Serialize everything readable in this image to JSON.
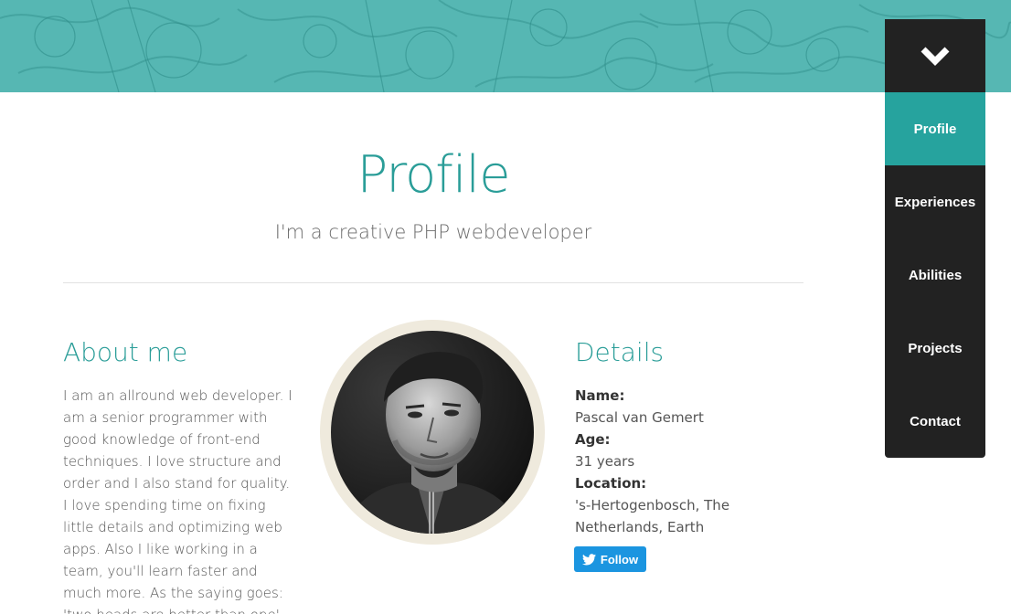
{
  "colors": {
    "accent": "#2a9d98",
    "nav_bg": "#222222",
    "nav_active": "#26a39e",
    "banner": "#55b6b3",
    "twitter": "#1b95e0"
  },
  "nav": {
    "toggle_icon": "chevron-down-icon",
    "items": [
      {
        "label": "Profile",
        "active": true
      },
      {
        "label": "Experiences",
        "active": false
      },
      {
        "label": "Abilities",
        "active": false
      },
      {
        "label": "Projects",
        "active": false
      },
      {
        "label": "Contact",
        "active": false
      }
    ]
  },
  "header": {
    "title": "Profile",
    "subtitle": "I'm a creative PHP webdeveloper"
  },
  "about": {
    "heading": "About me",
    "text": "I am an allround web developer. I am a senior programmer with good knowledge of front-end techniques. I love structure and order and I also stand for quality. I love spending time on fixing little details and optimizing web apps. Also I like working in a team, you'll learn faster and much more. As the saying goes: 'two heads are better than one'."
  },
  "details": {
    "heading": "Details",
    "name_label": "Name:",
    "name_value": "Pascal van Gemert",
    "age_label": "Age:",
    "age_value": "31 years",
    "location_label": "Location:",
    "location_value": "'s-Hertogenbosch, The Netherlands, Earth",
    "follow_label": "Follow",
    "follow_icon": "twitter-bird-icon"
  }
}
